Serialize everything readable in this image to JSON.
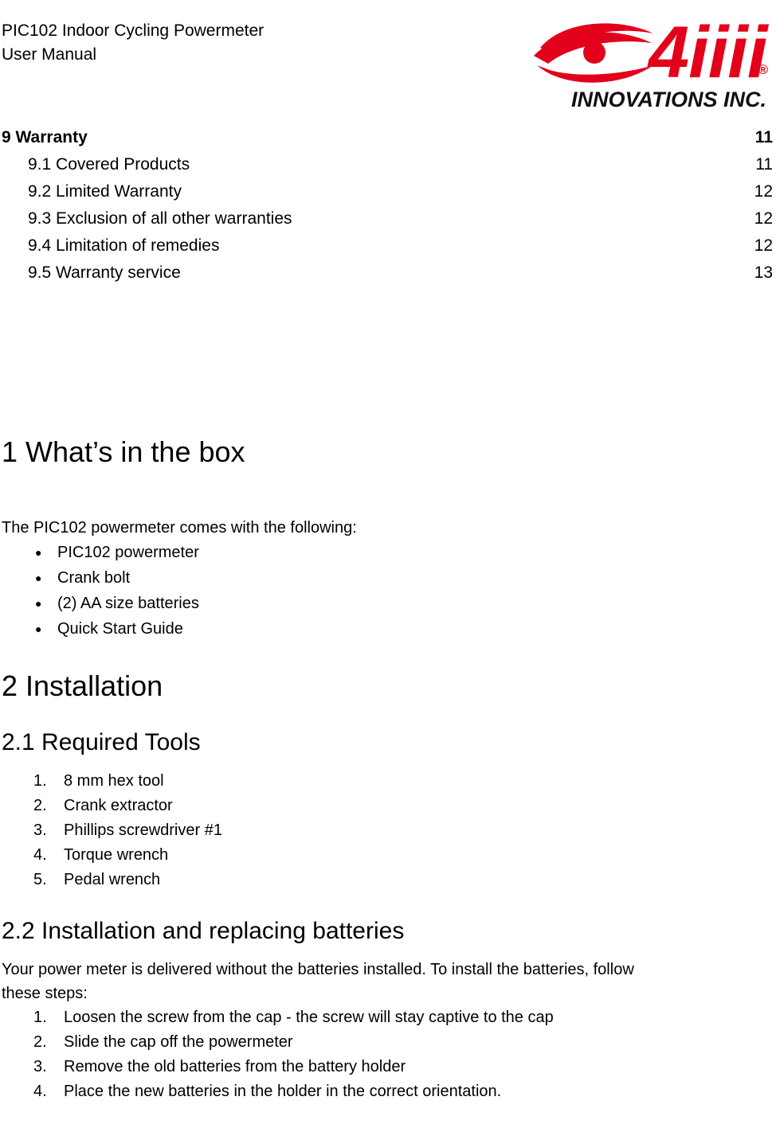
{
  "header": {
    "title_line1": "PIC102 Indoor Cycling Powermeter",
    "title_line2": "User Manual",
    "logo": {
      "wordmark": "4iiii",
      "registered": "®",
      "tagline": "INNOVATIONS INC.",
      "brand_color": "#e3001b",
      "tagline_color": "#111111"
    }
  },
  "toc": {
    "entries": [
      {
        "label": "9 Warranty",
        "page": "11",
        "level": 1
      },
      {
        "label": "9.1 Covered Products",
        "page": "11",
        "level": 2
      },
      {
        "label": "9.2 Limited Warranty",
        "page": "12",
        "level": 2
      },
      {
        "label": "9.3 Exclusion of all other warranties",
        "page": "12",
        "level": 2
      },
      {
        "label": "9.4 Limitation of remedies",
        "page": "12",
        "level": 2
      },
      {
        "label": "9.5 Warranty service",
        "page": "13",
        "level": 2
      }
    ]
  },
  "sections": {
    "whats_in_the_box": {
      "heading": "1 What’s in the box",
      "intro": "The PIC102 powermeter comes with the following:",
      "items": [
        "PIC102 powermeter",
        "Crank bolt",
        "(2) AA size batteries",
        "Quick Start Guide"
      ]
    },
    "installation": {
      "heading": "2 Installation"
    },
    "required_tools": {
      "heading": "2.1 Required Tools",
      "items": [
        "8 mm hex tool",
        "Crank extractor",
        "Phillips screwdriver #1",
        "Torque wrench",
        "Pedal wrench"
      ]
    },
    "replacing_batteries": {
      "heading": "2.2 Installation and replacing batteries",
      "intro_line1": "Your power meter is delivered without the batteries installed. To install the batteries, follow",
      "intro_line2": "these steps:",
      "steps": [
        "Loosen the screw from the cap - the screw will stay captive to the cap",
        "Slide the cap off the powermeter",
        "Remove the old batteries from the battery holder",
        "Place the new batteries in the holder in the correct orientation."
      ]
    }
  }
}
